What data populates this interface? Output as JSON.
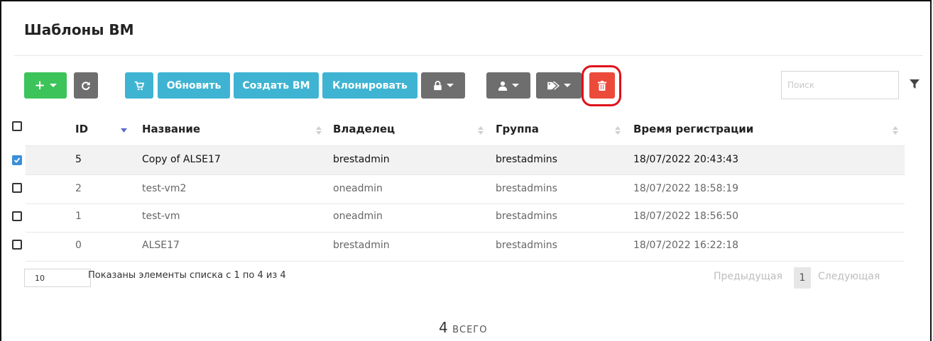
{
  "page": {
    "title": "Шаблоны ВМ"
  },
  "toolbar": {
    "add_label": "+",
    "update_label": "Обновить",
    "create_vm_label": "Создать ВМ",
    "clone_label": "Клонировать"
  },
  "search": {
    "placeholder": "Поиск",
    "value": ""
  },
  "table": {
    "headers": {
      "id": "ID",
      "name": "Название",
      "owner": "Владелец",
      "group": "Группа",
      "regtime": "Время регистрации"
    },
    "rows": [
      {
        "checked": true,
        "id": "5",
        "name": "Copy of ALSE17",
        "owner": "brestadmin",
        "group": "brestadmins",
        "regtime": "18/07/2022 20:43:43"
      },
      {
        "checked": false,
        "id": "2",
        "name": "test-vm2",
        "owner": "oneadmin",
        "group": "brestadmins",
        "regtime": "18/07/2022 18:58:19"
      },
      {
        "checked": false,
        "id": "1",
        "name": "test-vm",
        "owner": "oneadmin",
        "group": "brestadmins",
        "regtime": "18/07/2022 18:56:50"
      },
      {
        "checked": false,
        "id": "0",
        "name": "ALSE17",
        "owner": "brestadmin",
        "group": "brestadmins",
        "regtime": "18/07/2022 16:22:18"
      }
    ]
  },
  "footer": {
    "page_length": "10",
    "info": "Показаны элементы списка с 1 по 4 из 4",
    "prev_label": "Предыдущая",
    "page_number": "1",
    "next_label": "Следующая",
    "total_count": "4",
    "total_label": "ВСЕГО"
  },
  "colors": {
    "add": "#3cc35a",
    "primary": "#3fb4d2",
    "neutral": "#6e6e6e",
    "delete": "#ec4b3c",
    "highlight": "#e0101a"
  },
  "icons": [
    "plus-icon",
    "refresh-icon",
    "cart-icon",
    "lock-icon",
    "user-icon",
    "tags-icon",
    "trash-icon",
    "filter-icon",
    "sort-icon"
  ]
}
